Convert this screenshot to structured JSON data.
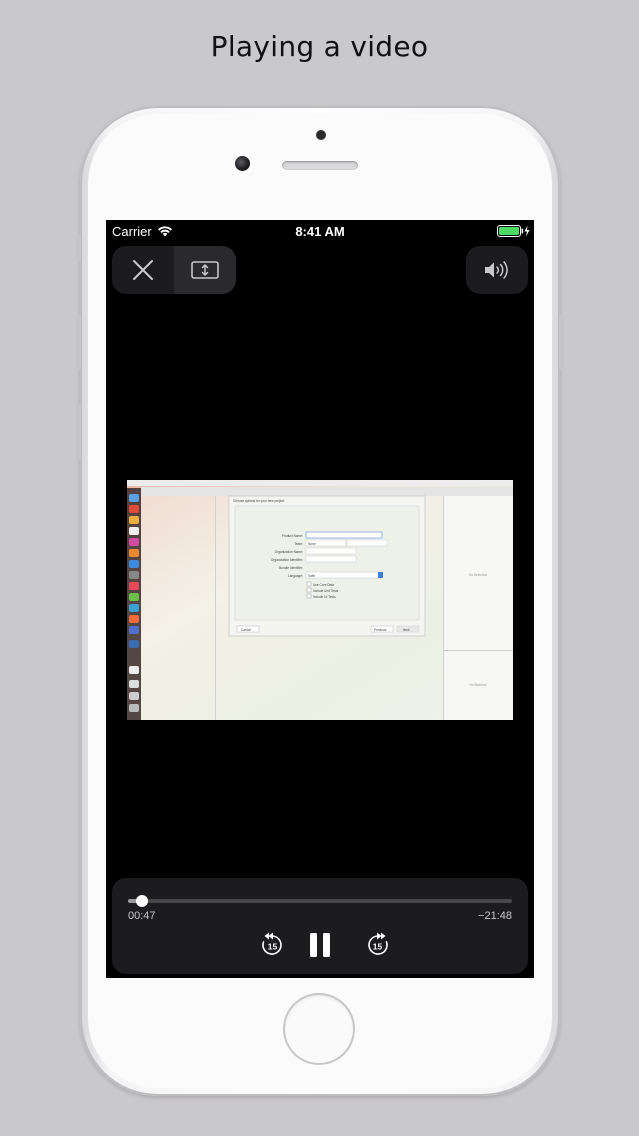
{
  "caption": "Playing a video",
  "status_bar": {
    "carrier": "Carrier",
    "time": "8:41 AM",
    "wifi_icon": "wifi-icon",
    "battery_icon": "battery-charging-icon",
    "battery_color": "#4cd964"
  },
  "top_controls": {
    "close_icon": "close-icon",
    "resize_icon": "aspect-fill-icon",
    "volume_icon": "speaker-volume-icon"
  },
  "video": {
    "desktop_screenshot": {
      "dialog_title": "Choose options for your new project:",
      "fields": [
        {
          "label": "Product Name:",
          "value": ""
        },
        {
          "label": "Team:",
          "value": "None"
        },
        {
          "label": "Organization Name:",
          "value": ""
        },
        {
          "label": "Organization Identifier:",
          "value": ""
        },
        {
          "label": "Bundle Identifier:",
          "value": ""
        },
        {
          "label": "Language:",
          "value": "Swift"
        }
      ],
      "checkboxes": [
        "Use Core Data",
        "Include Unit Tests",
        "Include UI Tests"
      ],
      "cancel": "Cancel",
      "previous": "Previous",
      "next": "Next",
      "no_selection_1": "No Selection",
      "no_selection_2": "No Matches"
    }
  },
  "player": {
    "elapsed": "00:47",
    "remaining": "−21:48",
    "progress": 0.036,
    "rewind_seconds": "15",
    "forward_seconds": "15",
    "rewind_icon": "skip-back-15-icon",
    "pause_icon": "pause-icon",
    "forward_icon": "skip-forward-15-icon"
  }
}
